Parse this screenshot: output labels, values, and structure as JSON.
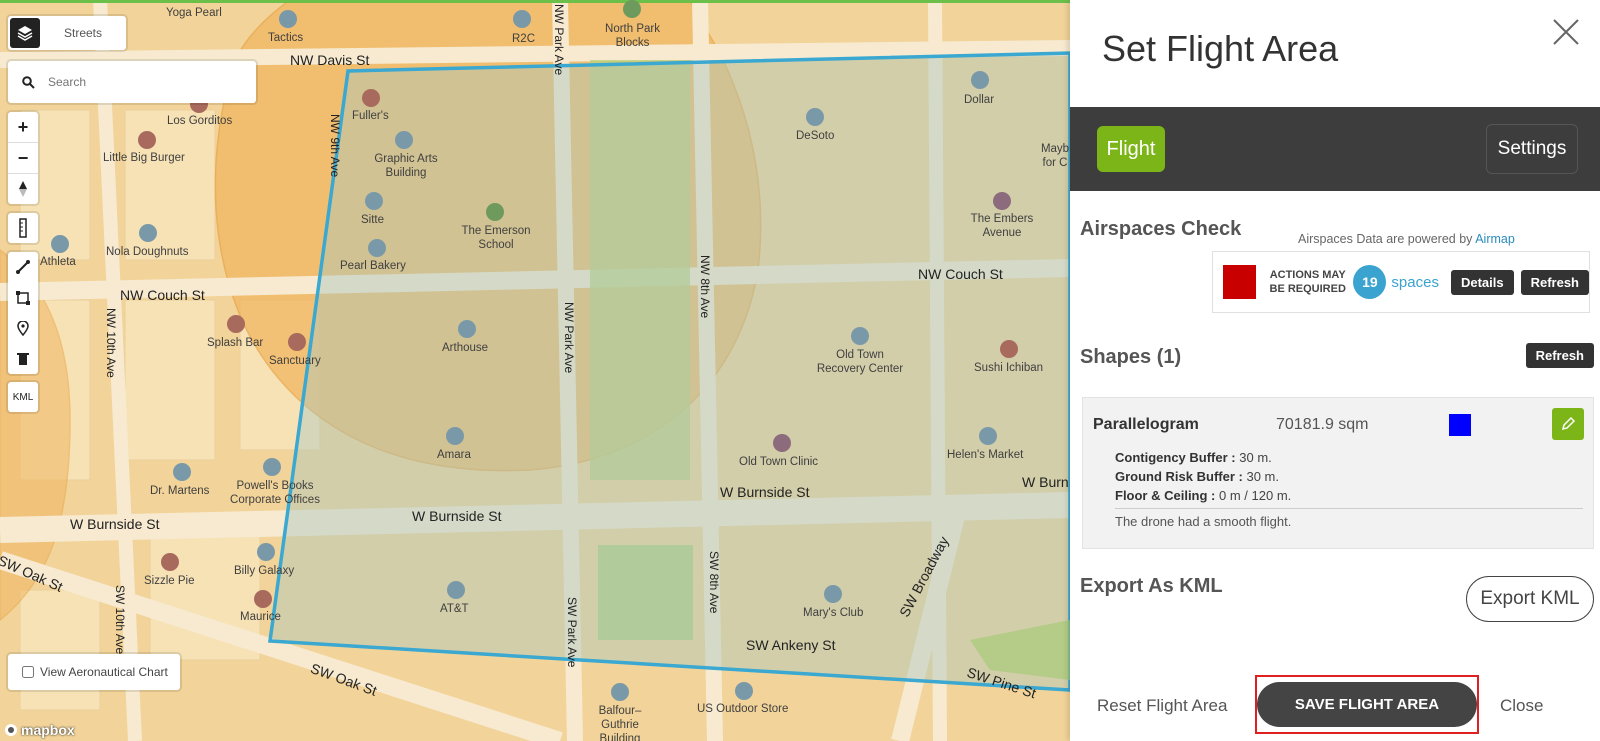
{
  "map": {
    "style_label": "Streets",
    "search_placeholder": "Search",
    "kml_label": "KML",
    "aero_label": "View Aeronautical Chart",
    "attribution": "mapbox",
    "streets": {
      "nw_davis": "NW Davis St",
      "nw_couch_left": "NW Couch St",
      "nw_couch_right": "NW Couch St",
      "w_burnside_left": "W Burnside St",
      "w_burnside_mid": "W Burnside St",
      "w_burnside_right": "W Burnside St",
      "w_burnside_edge": "W Burn",
      "sw_oak_left": "SW Oak St",
      "sw_oak_bottom": "SW Oak St",
      "sw_ankeny": "SW Ankeny St",
      "sw_pine": "SW Pine St",
      "sw_broadway": "SW Broadway",
      "nw_park_top": "NW Park Ave",
      "nw_park_mid": "NW Park Ave",
      "nw_8th": "NW 8th Ave",
      "nw_9th": "NW 9th Ave",
      "nw_10th": "NW 10th Ave",
      "sw_10th": "SW 10th Ave",
      "sw_park": "SW Park Ave",
      "sw_8th": "SW 8th Ave"
    },
    "pois": {
      "yoga_pearl": "Yoga Pearl",
      "tactics": "Tactics",
      "r2c": "R2C",
      "north_park_blocks": "North Park Blocks",
      "los_gorditos": "Los Gorditos",
      "little_big_burger": "Little Big Burger",
      "fullers": "Fuller's",
      "graphic_arts": "Graphic Arts Building",
      "desoto": "DeSoto",
      "dollar": "Dollar",
      "sitte": "Sitte",
      "emerson": "The Emerson School",
      "embers": "The Embers Avenue",
      "nola": "Nola Doughnuts",
      "athleta": "Athleta",
      "pearl_bakery": "Pearl Bakery",
      "splash_bar": "Splash Bar",
      "sanctuary": "Sanctuary",
      "arthouse": "Arthouse",
      "old_town_recovery": "Old Town Recovery Center",
      "sushi_ichiban": "Sushi Ichiban",
      "amara": "Amara",
      "old_town_clinic": "Old Town Clinic",
      "helens_market": "Helen's Market",
      "dr_martens": "Dr. Martens",
      "powells": "Powell's Books Corporate Offices",
      "sizzle_pie": "Sizzle Pie",
      "billy_galaxy": "Billy Galaxy",
      "maurice": "Maurice",
      "att": "AT&T",
      "marys_club": "Mary's Club",
      "balfour": "Balfour–Guthrie Building",
      "us_outdoor": "US Outdoor Store",
      "mayb": "Mayb for C"
    }
  },
  "panel": {
    "title": "Set Flight Area",
    "tabs": {
      "flight": "Flight",
      "settings": "Settings"
    },
    "airspaces": {
      "title": "Airspaces Check",
      "powered_prefix": "Airspaces Data are powered by",
      "powered_link": "Airmap",
      "status_line1": "ACTIONS MAY",
      "status_line2": "BE REQUIRED",
      "count": "19",
      "count_label": "spaces",
      "details_btn": "Details",
      "refresh_btn": "Refresh"
    },
    "shapes": {
      "title": "Shapes (1)",
      "refresh_btn": "Refresh",
      "items": [
        {
          "name": "Parallelogram",
          "area": "70181.9 sqm",
          "color": "#0000ff",
          "contingency_label": "Contigency Buffer :",
          "contingency_value": "30 m.",
          "ground_label": "Ground Risk Buffer :",
          "ground_value": "30 m.",
          "floor_label": "Floor & Ceiling :",
          "floor_value": "0 m / 120 m.",
          "note": "The drone had a smooth flight."
        }
      ]
    },
    "export": {
      "title": "Export As KML",
      "button": "Export KML"
    },
    "footer": {
      "reset": "Reset Flight Area",
      "save": "SAVE FLIGHT AREA",
      "close": "Close"
    }
  },
  "colors": {
    "accent_green": "#7cb518",
    "flight_polygon": "#3aa8d0",
    "status_red": "#c80000",
    "highlight_outline": "#e02020"
  }
}
